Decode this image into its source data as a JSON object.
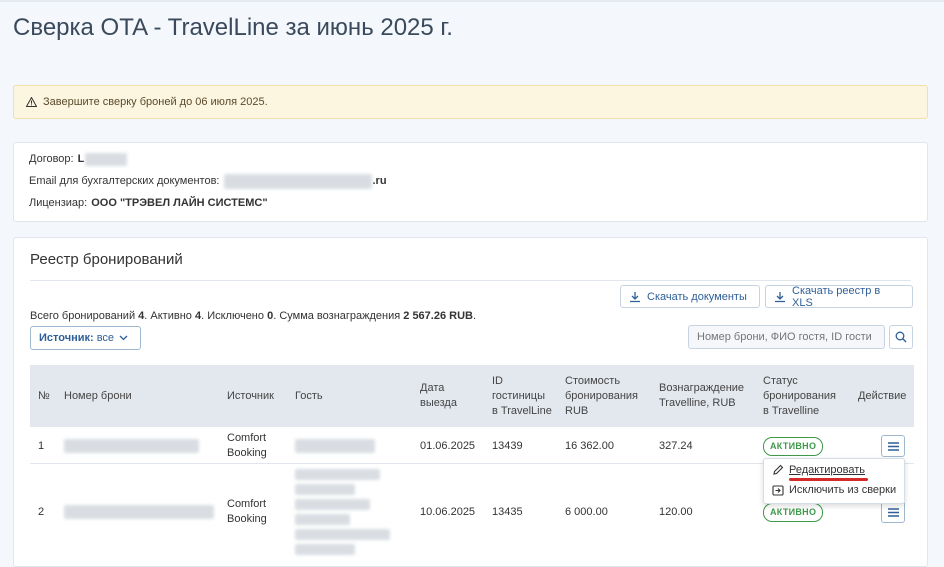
{
  "page": {
    "title": "Сверка OTA - TravelLine за июнь 2025 г."
  },
  "alert": {
    "text": "Завершите сверку броней до 06 июля 2025."
  },
  "contract": {
    "contract_label": "Договор:",
    "contract_value_visible": "L",
    "email_label": "Email для бухгалтерских документов:",
    "email_suffix": ".ru",
    "licensor_label": "Лицензиар:",
    "licensor_value": "ООО \"ТРЭВЕЛ ЛАЙН СИСТЕМС\""
  },
  "registry": {
    "title": "Реестр бронирований",
    "download_docs_label": "Скачать документы",
    "download_xls_label": "Скачать реестр в XLS",
    "summary": {
      "total_label": "Всего бронирований",
      "total": "4",
      "active_label": ". Активно",
      "active": "4",
      "excluded_label": ". Исключено",
      "excluded": "0",
      "fee_label": ". Сумма вознаграждения",
      "fee": "2 567.26 RUB",
      "end": "."
    },
    "source_filter": {
      "label": "Источник:",
      "value": "все"
    },
    "search": {
      "placeholder": "Номер брони, ФИО гостя, ID гости"
    },
    "columns": {
      "num": "№",
      "booking": "Номер брони",
      "source": "Источник",
      "guest": "Гость",
      "checkout_1": "Дата",
      "checkout_2": "выезда",
      "hotel_id_1": "ID",
      "hotel_id_2": "гостиницы",
      "hotel_id_3": "в TravelLine",
      "cost_1": "Стоимость",
      "cost_2": "бронирования",
      "cost_3": "RUB",
      "fee_1": "Вознаграждение",
      "fee_2": "Travelline, RUB",
      "status_1": "Статус",
      "status_2": "бронирования",
      "status_3": "в Travelline",
      "action": "Действие"
    },
    "rows": [
      {
        "num": "1",
        "source_1": "Comfort",
        "source_2": "Booking",
        "checkout": "01.06.2025",
        "hotel_id": "13439",
        "cost": "16 362.00",
        "fee": "327.24",
        "status": "АКТИВНО"
      },
      {
        "num": "2",
        "source_1": "Comfort",
        "source_2": "Booking",
        "checkout": "10.06.2025",
        "hotel_id": "13435",
        "cost": "6 000.00",
        "fee": "120.00",
        "status": "АКТИВНО"
      }
    ],
    "action_menu": {
      "edit": "Редактировать",
      "exclude": "Исключить из сверки"
    }
  },
  "colors": {
    "accent": "#2f5f99",
    "status_active": "#3f9a4a",
    "highlight": "#d42a2a",
    "alert_bg": "#fcf6e1"
  }
}
